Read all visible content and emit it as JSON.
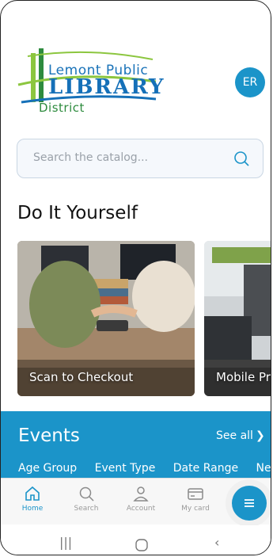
{
  "header": {
    "logo": {
      "line1": "Lemont Public",
      "line2": "LIBRARY",
      "line3": "District"
    },
    "avatar_initials": "ER"
  },
  "search": {
    "placeholder": "Search the catalog..."
  },
  "diy": {
    "title": "Do It Yourself",
    "cards": [
      {
        "label": "Scan to Checkout"
      },
      {
        "label": "Mobile Pr"
      }
    ]
  },
  "events": {
    "title": "Events",
    "see_all": "See all",
    "filters": [
      "Age Group",
      "Event Type",
      "Date Range",
      "Ne"
    ]
  },
  "bottom_nav": {
    "items": [
      {
        "label": "Home",
        "icon": "home-icon",
        "active": true
      },
      {
        "label": "Search",
        "icon": "search-icon",
        "active": false
      },
      {
        "label": "Account",
        "icon": "user-icon",
        "active": false
      },
      {
        "label": "My card",
        "icon": "card-icon",
        "active": false
      }
    ],
    "menu_icon": "menu-icon"
  },
  "colors": {
    "accent": "#1b94c9",
    "logo_blue": "#1570b8",
    "logo_green": "#2e8b3e"
  }
}
